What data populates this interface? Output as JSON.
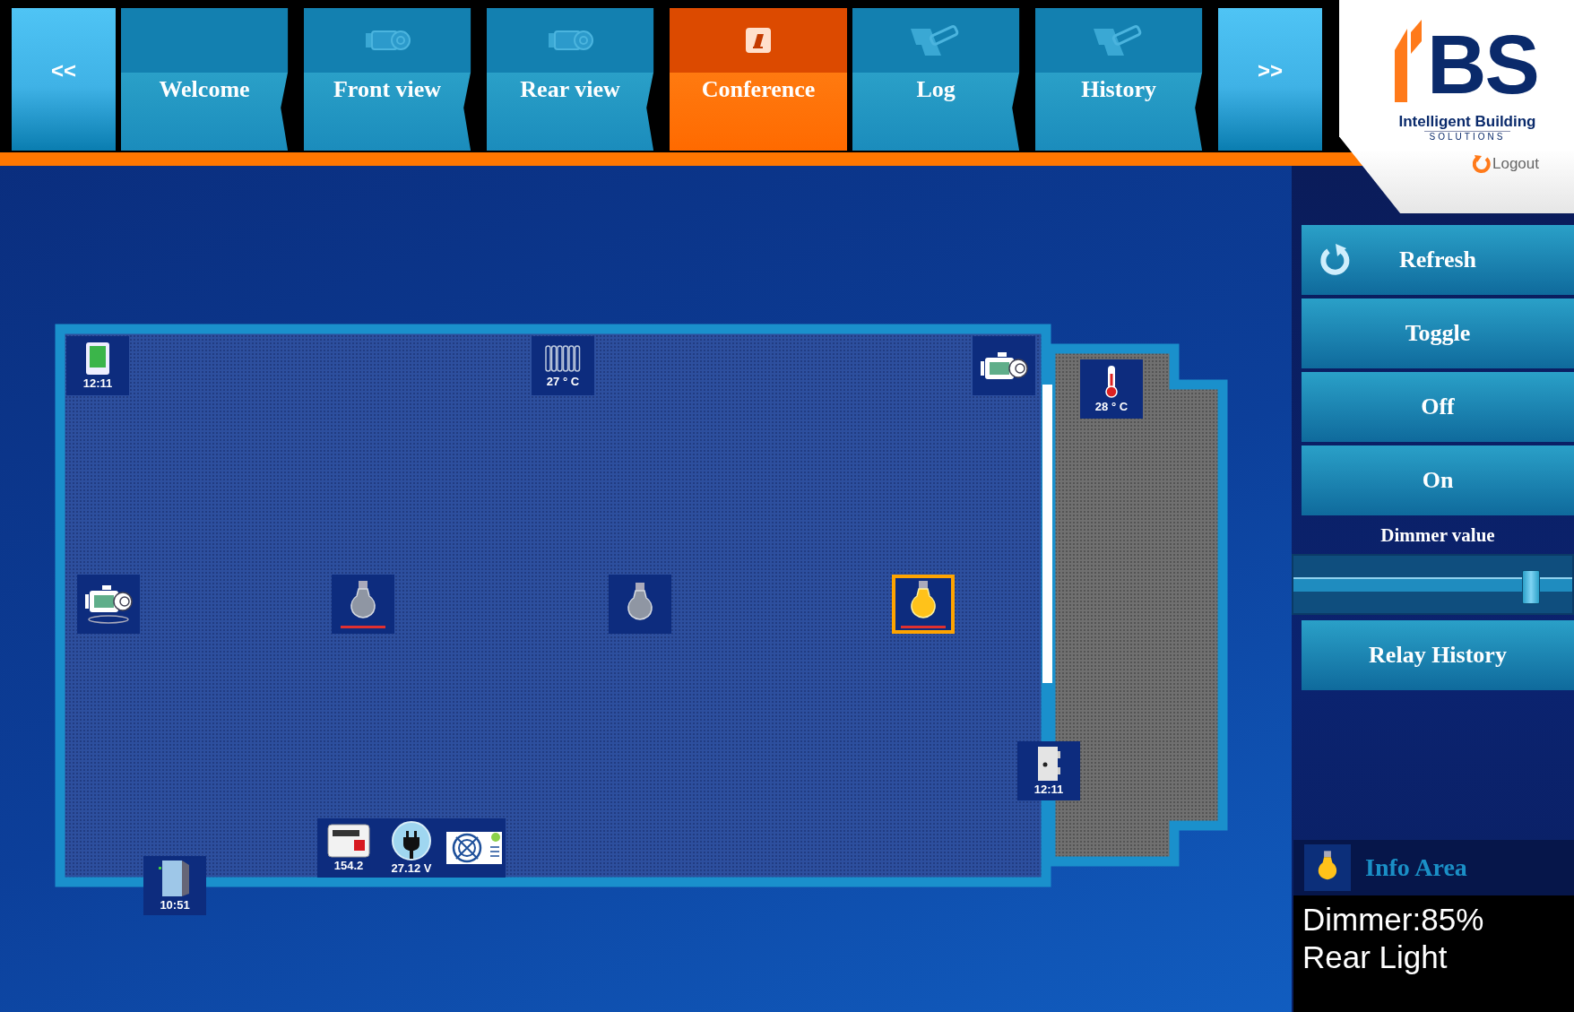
{
  "nav": {
    "prev": "<<",
    "next": ">>"
  },
  "tabs": [
    {
      "label": "Welcome",
      "selected": false
    },
    {
      "label": "Front view",
      "selected": false
    },
    {
      "label": "Rear view",
      "selected": false
    },
    {
      "label": "Conference",
      "selected": true
    },
    {
      "label": "Log",
      "selected": false
    },
    {
      "label": "History",
      "selected": false
    }
  ],
  "logo": {
    "letters": "BS",
    "tagline": "Intelligent Building",
    "subline": "SOLUTIONS"
  },
  "logout": "Logout",
  "devices": [
    {
      "kind": "thermostat",
      "label": "12:11",
      "selected": false
    },
    {
      "kind": "radiator",
      "label": "27 ° C",
      "selected": false
    },
    {
      "kind": "camera",
      "selected": false
    },
    {
      "kind": "thermometer",
      "label": "28 ° C",
      "selected": false
    },
    {
      "kind": "ptz_camera",
      "selected": false
    },
    {
      "kind": "bulb",
      "on": false,
      "indicator": true,
      "selected": false
    },
    {
      "kind": "bulb",
      "on": false,
      "indicator": false,
      "selected": false
    },
    {
      "kind": "bulb",
      "on": true,
      "indicator": true,
      "selected": true
    },
    {
      "kind": "door",
      "label": "12:11",
      "selected": false
    },
    {
      "kind": "meter",
      "label": "154.2",
      "selected": false
    },
    {
      "kind": "plug",
      "label": "27.12 V",
      "selected": false
    },
    {
      "kind": "vent",
      "selected": false
    },
    {
      "kind": "cabinet",
      "label": "10:51",
      "selected": false
    }
  ],
  "controls": {
    "buttons": [
      {
        "kind": "refresh",
        "label": "Refresh"
      },
      {
        "kind": "plain",
        "label": "Toggle"
      },
      {
        "kind": "plain",
        "label": "Off"
      },
      {
        "kind": "plain",
        "label": "On"
      }
    ],
    "dimmer": {
      "label": "Dimmer value",
      "level": 0.85
    },
    "relay_history": "Relay History"
  },
  "info": {
    "title": "Info Area",
    "lines": [
      "Dimmer:85%",
      "Rear Light"
    ]
  }
}
